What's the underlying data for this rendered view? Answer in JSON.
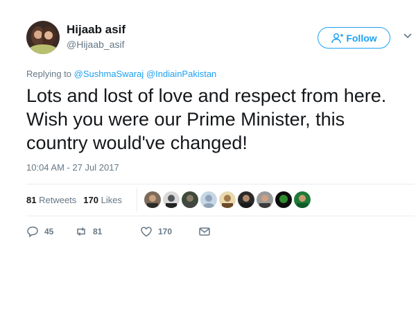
{
  "tweet": {
    "author_name": "Hijaab asif",
    "author_handle": "@Hijaab_asif",
    "follow_label": "Follow",
    "replying_prefix": "Replying to",
    "replying_to": [
      "@SushmaSwaraj",
      "@IndiainPakistan"
    ],
    "text": "Lots and lost of love and respect from here. Wish you were our Prime Minister, this country would've changed!",
    "timestamp": "10:04 AM - 27 Jul 2017",
    "retweets_count": "81",
    "retweets_label": "Retweets",
    "likes_count": "170",
    "likes_label": "Likes",
    "actions": {
      "reply_count": "45",
      "retweet_count": "81",
      "like_count": "170"
    }
  },
  "icons": {
    "follow": "add-user-icon",
    "menu": "chevron-down-icon",
    "reply": "reply-icon",
    "retweet": "retweet-icon",
    "like": "heart-icon",
    "message": "envelope-icon"
  },
  "colors": {
    "accent": "#1da1f2",
    "muted": "#657786",
    "text": "#14171a",
    "divider": "#e6ecf0"
  }
}
